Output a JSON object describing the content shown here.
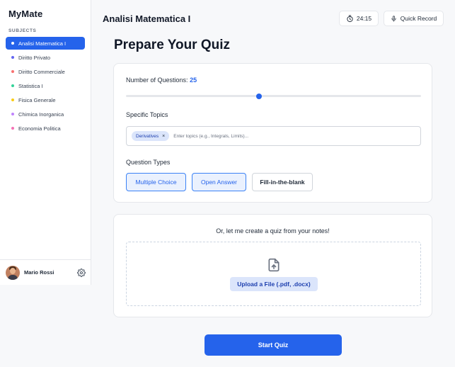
{
  "sidebar": {
    "app_title": "MyMate",
    "section_label": "SUBJECTS",
    "items": [
      {
        "label": "Analisi Matematica I",
        "color": "#ffffff",
        "active": true
      },
      {
        "label": "Diritto Privato",
        "color": "#6366f1",
        "active": false
      },
      {
        "label": "Diritto Commerciale",
        "color": "#f87171",
        "active": false
      },
      {
        "label": "Statistica I",
        "color": "#34d399",
        "active": false
      },
      {
        "label": "Fisica Generale",
        "color": "#facc15",
        "active": false
      },
      {
        "label": "Chimica Inorganica",
        "color": "#c084fc",
        "active": false
      },
      {
        "label": "Economia Politica",
        "color": "#f472b6",
        "active": false
      }
    ],
    "user": {
      "name": "Mario Rossi",
      "avatar_icon": "avatar-photo",
      "settings_icon": "gear-icon"
    }
  },
  "header": {
    "title": "Analisi Matematica I",
    "timer": {
      "icon": "stopwatch-icon",
      "value": "24:15"
    },
    "record": {
      "icon": "microphone-icon",
      "label": "Quick Record"
    }
  },
  "main": {
    "title": "Prepare Your Quiz",
    "questions": {
      "label": "Number of Questions:",
      "value": "25",
      "slider_fraction": 0.45
    },
    "topics": {
      "label": "Specific Topics",
      "chips": [
        {
          "label": "Derivatives",
          "remove": "×"
        }
      ],
      "placeholder": "Enter topics (e.g., Integrals, Limits)..."
    },
    "question_types": {
      "label": "Question Types",
      "options": [
        {
          "label": "Multiple Choice",
          "selected": true
        },
        {
          "label": "Open Answer",
          "selected": true
        },
        {
          "label": "Fill-in-the-blank",
          "selected": false
        }
      ]
    },
    "upload": {
      "heading": "Or, let me create a quiz from your notes!",
      "icon": "file-upload-icon",
      "button_label": "Upload a File (.pdf, .docx)"
    },
    "start_label": "Start Quiz"
  },
  "colors": {
    "accent": "#2563eb",
    "accent_light": "#dbe5fb"
  }
}
